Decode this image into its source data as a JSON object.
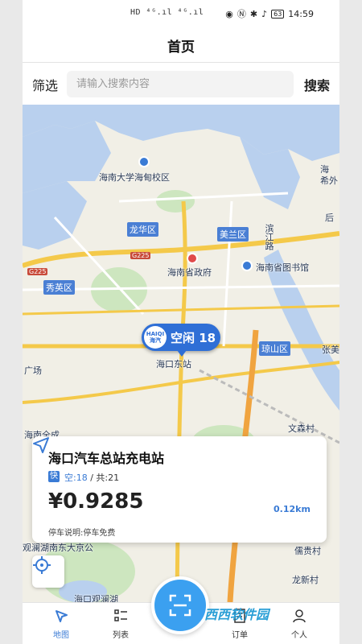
{
  "status_bar": {
    "left_icons": "HD ⁴ᴳ.ıl ⁴ᴳ.ıl",
    "battery": "63",
    "time": "14:59"
  },
  "header": {
    "title": "首页"
  },
  "search": {
    "filter_label": "筛选",
    "placeholder": "请输入搜索内容",
    "search_label": "搜索"
  },
  "map": {
    "labels": {
      "haida": "海南大学海甸校区",
      "gov": "海南省政府",
      "library": "海南省图书馆",
      "haikou_east": "海口东站",
      "binjiang": "滨江路",
      "guangchang": "广场",
      "haikou_guanlan": "海口观澜湖",
      "wenchuncun": "文森村",
      "chuanhucun": "儒贵村",
      "longxincun": "龙新村",
      "hainan_left": "海南全成",
      "hai_right": "海",
      "xi_right": "希外",
      "hou_right": "后",
      "zhang_right": "张美",
      "guanlan_top": "观澜湖南东大京公"
    },
    "districts": {
      "longhua": "龙华区",
      "meilan": "美兰区",
      "xiuying": "秀英区",
      "qiongshan": "琼山区"
    },
    "roads": {
      "g225_a": "G225",
      "g225_b": "G225"
    },
    "marker": {
      "logo": "HAIQI 海汽",
      "status": "空闲 18"
    }
  },
  "station": {
    "name": "海口汽车总站充电站",
    "fast_label": "快",
    "free_label": "空:18",
    "total_label": "/ 共:21",
    "price": "¥0.9285",
    "parking_note": "停车说明:停车免费",
    "distance": "0.12km"
  },
  "tabs": [
    {
      "label": "地图",
      "icon": "map-pin-icon"
    },
    {
      "label": "列表",
      "icon": "list-icon"
    },
    {
      "label": "订单",
      "icon": "order-icon"
    },
    {
      "label": "个人",
      "icon": "user-icon"
    }
  ],
  "watermark": "西西软件园",
  "colors": {
    "accent": "#3a7bd5",
    "district": "#4a7fd4",
    "marker": "#2f6fd6",
    "scan": "#3ba0f0"
  }
}
